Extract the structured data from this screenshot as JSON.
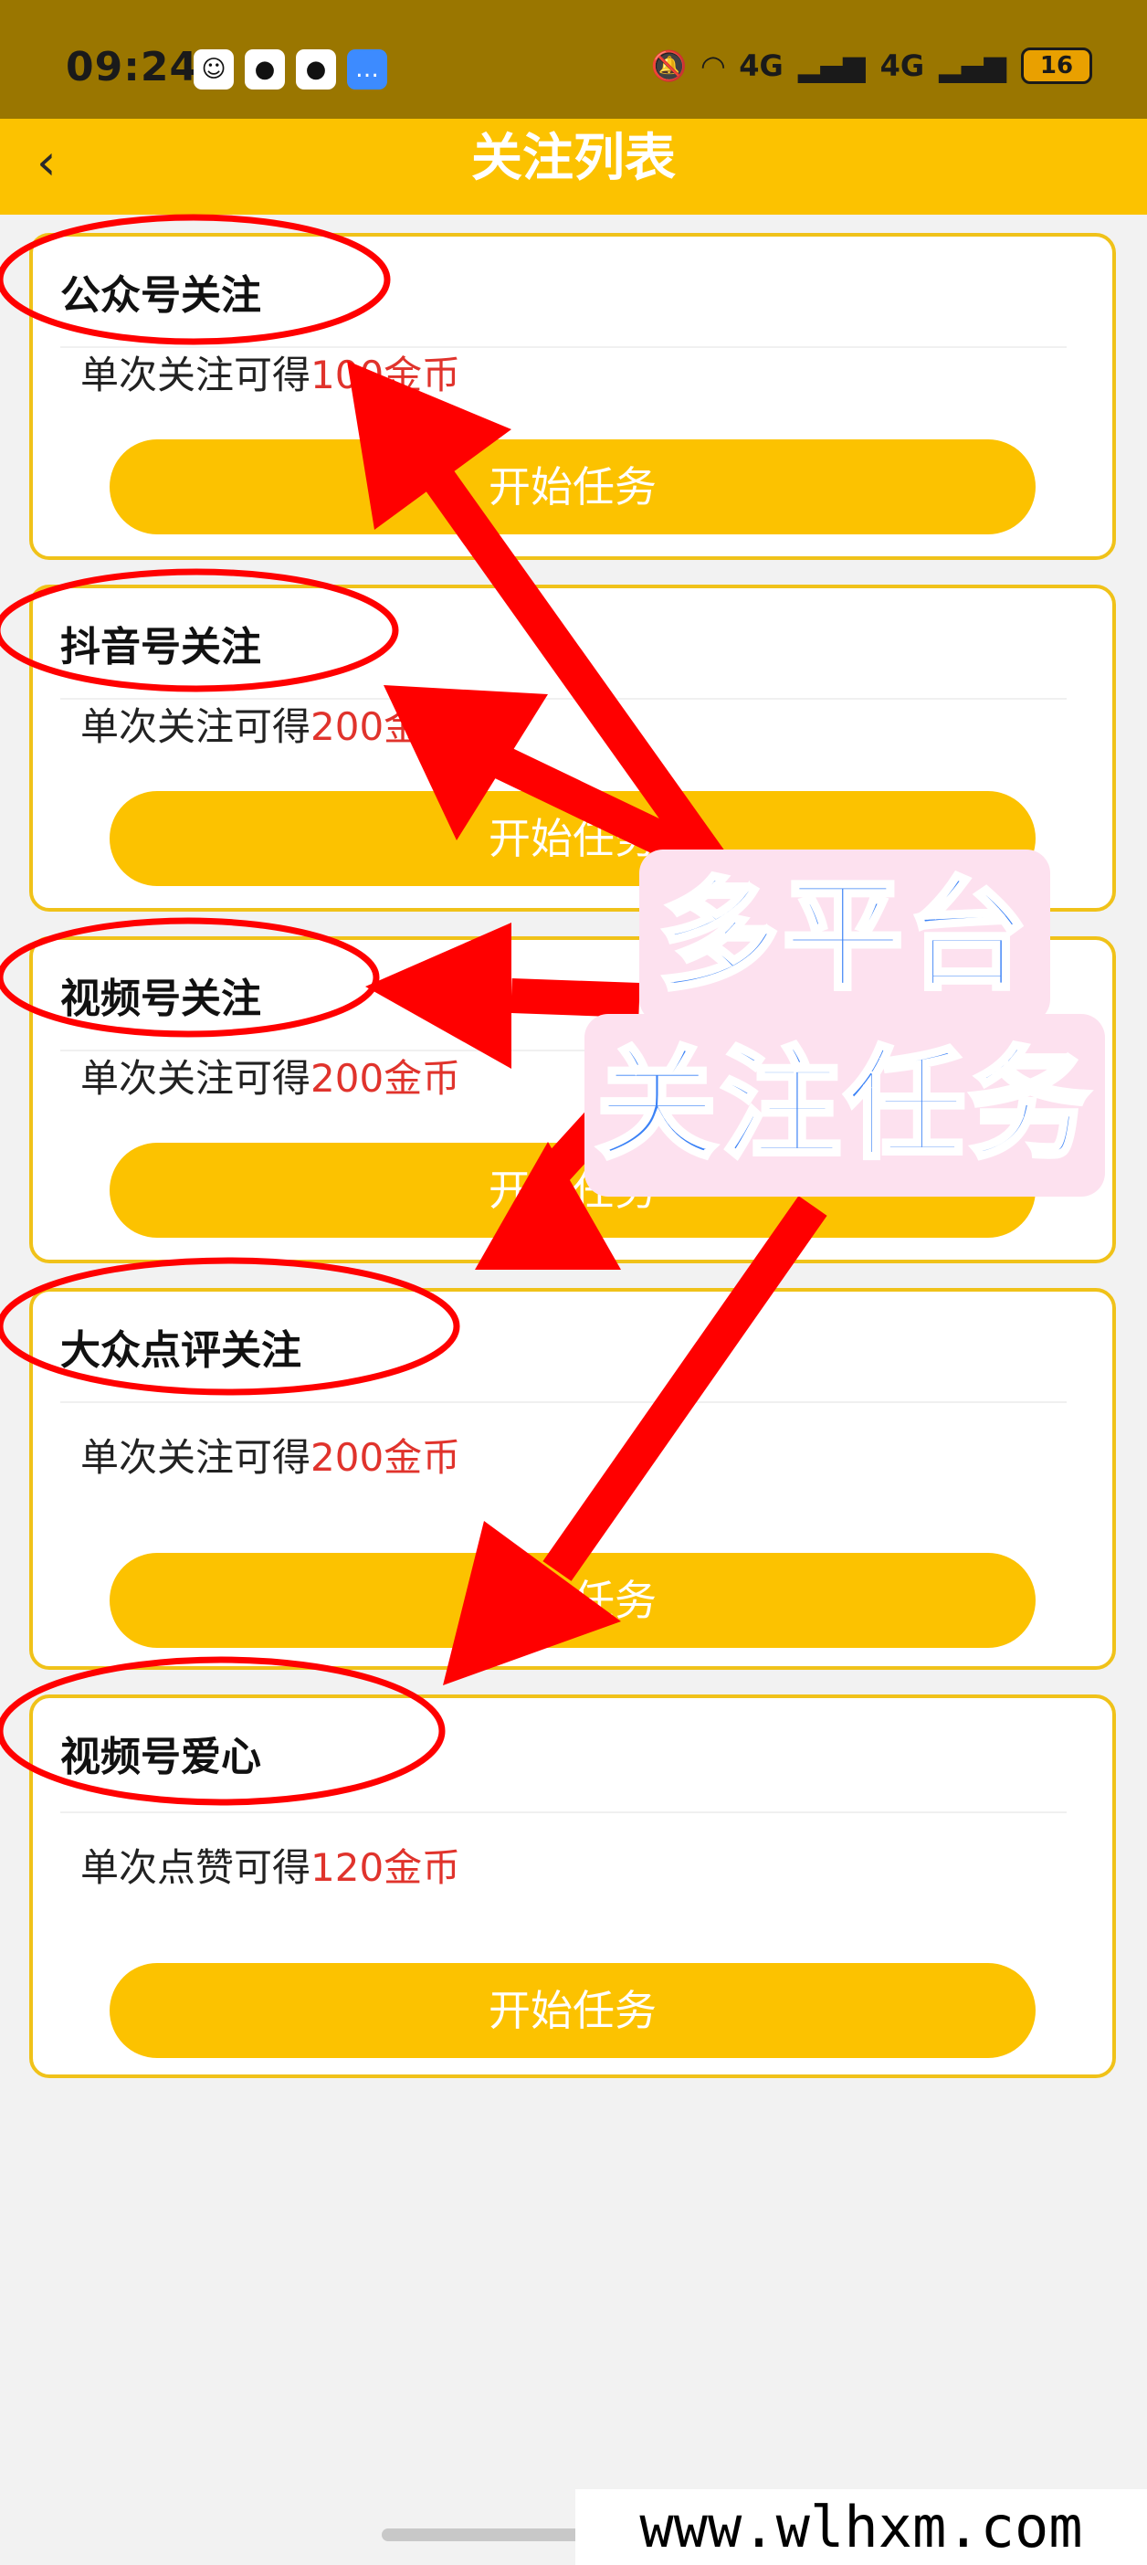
{
  "status_bar": {
    "time": "09:24",
    "network_labels": [
      "4G",
      "4G"
    ],
    "battery": "16"
  },
  "nav": {
    "back_icon": "‹",
    "title": "关注列表"
  },
  "cards": [
    {
      "title": "公众号关注",
      "desc_prefix": "单次关注可得",
      "reward": "100金币",
      "button": "开始任务"
    },
    {
      "title": "抖音号关注",
      "desc_prefix": "单次关注可得",
      "reward": "200金币",
      "button": "开始任务"
    },
    {
      "title": "视频号关注",
      "desc_prefix": "单次关注可得",
      "reward": "200金币",
      "button": "开始任务"
    },
    {
      "title": "大众点评关注",
      "desc_prefix": "单次关注可得",
      "reward": "200金币",
      "button": "开始任务"
    },
    {
      "title": "视频号爱心",
      "desc_prefix": "单次点赞可得",
      "reward": "120金币",
      "button": "开始任务"
    }
  ],
  "promo": {
    "line1": "多平台",
    "line2": "关注任务"
  },
  "watermark": "www.wlhxm.com",
  "colors": {
    "accent": "#fcc200",
    "reward": "#e0332c",
    "annotation": "#ff0000",
    "promo_text": "#3b82f6"
  }
}
